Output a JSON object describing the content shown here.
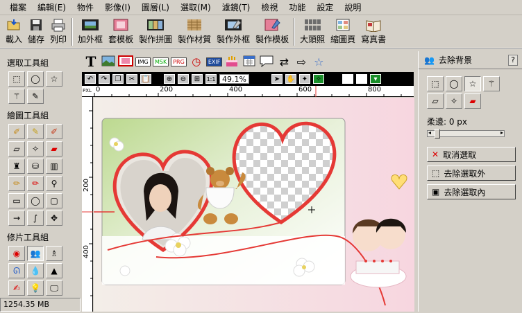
{
  "menu": [
    "檔案",
    "編輯(E)",
    "物件",
    "影像(I)",
    "圖層(L)",
    "選取(M)",
    "濾鏡(T)",
    "檢視",
    "功能",
    "設定",
    "說明"
  ],
  "toolbar": {
    "load": "載入",
    "save": "儲存",
    "print": "列印",
    "add_frame": "加外框",
    "apply_template": "套模板",
    "make_collage": "製作拼圖",
    "make_texture": "製作材質",
    "make_frame": "製作外框",
    "make_template": "製作模板",
    "big_portrait": "大頭照",
    "thumbnail": "縮圖頁",
    "photo_book": "寫真書"
  },
  "left_panel": {
    "select_group": "選取工具組",
    "draw_group": "繪圖工具組",
    "retouch_group": "修片工具組"
  },
  "status": {
    "memory": "1254.35 MB"
  },
  "effects": {
    "text_icon": "T",
    "img": "IMG",
    "msk": "MSK",
    "prg": "PRG",
    "exif": "EXIF"
  },
  "canvasbar": {
    "zoom": "49.1%",
    "fit": "1:1"
  },
  "ruler": {
    "corner": "PXL",
    "top": [
      "0",
      "200",
      "400",
      "600",
      "800"
    ],
    "left": [
      "200",
      "400"
    ]
  },
  "right_panel": {
    "title": "去除背景",
    "help": "?",
    "feather_label": "柔邊: 0 px",
    "feather_value": 0,
    "cancel_selection": "取消選取",
    "remove_outside": "去除選取外",
    "remove_inside": "去除選取內"
  },
  "colors": {
    "canvas_bg": "#fbe6ec",
    "heart_red": "#e53935",
    "frame_green": "#c6dfa3",
    "accent_blue": "#1f4b9c"
  }
}
